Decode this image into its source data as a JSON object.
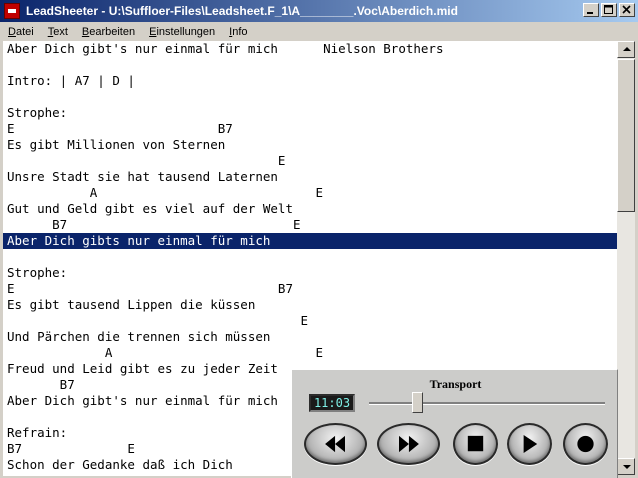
{
  "window": {
    "title": "LeadSheeter - U:\\Suffloer-Files\\Leadsheet.F_1\\A________.Voc\\Aberdich.mid"
  },
  "menu": [
    {
      "underline": "D",
      "rest": "atei"
    },
    {
      "underline": "T",
      "rest": "ext"
    },
    {
      "underline": "B",
      "rest": "earbeiten"
    },
    {
      "underline": "E",
      "rest": "instellungen"
    },
    {
      "underline": "I",
      "rest": "nfo"
    }
  ],
  "lyrics": {
    "selected_index": 12,
    "lines": [
      "Aber Dich gibt's nur einmal für mich      Nielson Brothers",
      "",
      "Intro: | A7 | D |",
      "",
      "Strophe:",
      "E                           B7",
      "Es gibt Millionen von Sternen",
      "                                    E",
      "Unsre Stadt sie hat tausend Laternen",
      "           A                             E",
      "Gut und Geld gibt es viel auf der Welt",
      "      B7                              E",
      "Aber Dich gibts nur einmal für mich",
      "",
      "Strophe:",
      "E                                   B7",
      "Es gibt tausend Lippen die küssen",
      "                                       E",
      "Und Pärchen die trennen sich müssen",
      "             A                           E",
      "Freud und Leid gibt es zu jeder Zeit",
      "       B7",
      "Aber Dich gibt's nur einmal für mich",
      "",
      "Refrain:",
      "B7              E",
      "Schon der Gedanke daß ich Dich"
    ]
  },
  "transport": {
    "title": "Transport",
    "time": "11:03",
    "position_fraction": 0.19,
    "buttons": [
      {
        "name": "rewind-button",
        "icon": "rewind-icon"
      },
      {
        "name": "fast-forward-button",
        "icon": "fast-forward-icon"
      },
      {
        "name": "stop-button",
        "icon": "stop-icon"
      },
      {
        "name": "play-button",
        "icon": "play-icon"
      },
      {
        "name": "record-button",
        "icon": "record-icon"
      }
    ]
  },
  "colors": {
    "title_bar_start": "#0a246a",
    "title_bar_end": "#a6caf0",
    "selection": "#0a246a",
    "time_display_text": "#7ff0e6"
  }
}
